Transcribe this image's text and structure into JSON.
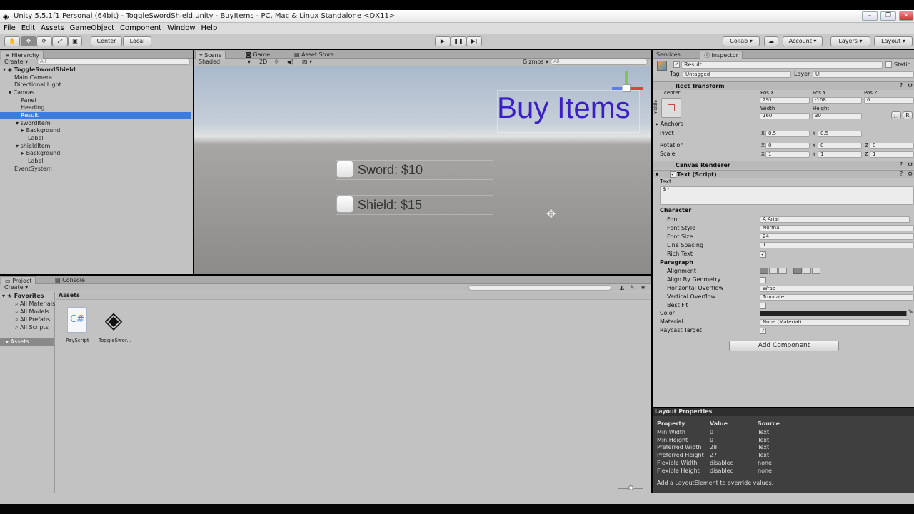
{
  "window": {
    "title": "Unity 5.5.1f1 Personal (64bit) - ToggleSwordShield.unity - BuyItems - PC, Mac & Linux Standalone <DX11>"
  },
  "menu": [
    "File",
    "Edit",
    "Assets",
    "GameObject",
    "Component",
    "Window",
    "Help"
  ],
  "toolbar": {
    "pivot": "Center",
    "space": "Local",
    "collab": "Collab",
    "account": "Account",
    "layers": "Layers",
    "layout": "Layout"
  },
  "hierarchy": {
    "tab": "Hierarchy",
    "create": "Create",
    "search_placeholder": "All",
    "scene": "ToggleSwordShield",
    "items": [
      "Main Camera",
      "Directional Light",
      "Canvas",
      "Panel",
      "Heading",
      "Result",
      "swordItem",
      "Background",
      "Label",
      "shieldItem",
      "Background",
      "Label",
      "EventSystem"
    ]
  },
  "scene": {
    "tabs": [
      "Scene",
      "Game",
      "Asset Store"
    ],
    "shading": "Shaded",
    "mode_2d": "2D",
    "gizmos": "Gizmos",
    "search_placeholder": "All",
    "heading": "Buy Items",
    "sword_label": "Sword: $10",
    "shield_label": "Shield: $15",
    "colors": {
      "heading": "#3a1ec7",
      "sky_top": "#a9b8cc",
      "ground": "#8d8b89"
    }
  },
  "project": {
    "tabs": [
      "Project",
      "Console"
    ],
    "create": "Create",
    "favorites": "Favorites",
    "fav_items": [
      "All Materials",
      "All Models",
      "All Prefabs",
      "All Scripts"
    ],
    "assets_root": "Assets",
    "breadcrumb": "Assets",
    "files": [
      {
        "name": "PayScript",
        "icon": "csharp-script-icon"
      },
      {
        "name": "ToggleSwor...",
        "icon": "unity-scene-icon"
      }
    ]
  },
  "inspector": {
    "tabs": [
      "Services",
      "Inspector"
    ],
    "object_name": "Result",
    "static": "Static",
    "tag_label": "Tag",
    "tag": "Untagged",
    "layer_label": "Layer",
    "layer": "UI",
    "rect_transform": "Rect Transform",
    "anchor_preset": "center",
    "anchor_side": "middle",
    "pos_x_label": "Pos X",
    "pos_y_label": "Pos Y",
    "pos_z_label": "Pos Z",
    "pos_x": "291",
    "pos_y": "-108",
    "pos_z": "0",
    "width_label": "Width",
    "height_label": "Height",
    "width": "160",
    "height": "30",
    "anchors": "Anchors",
    "pivot": "Pivot",
    "pivot_x": "0.5",
    "pivot_y": "0.5",
    "rotation": "Rotation",
    "rot_x": "0",
    "rot_y": "0",
    "rot_z": "0",
    "scale": "Scale",
    "scale_x": "1",
    "scale_y": "1",
    "scale_z": "1",
    "canvas_renderer": "Canvas Renderer",
    "text_script": "Text (Script)",
    "text_label": "Text",
    "text_value": "$ -",
    "character": "Character",
    "font_label": "Font",
    "font": "Arial",
    "font_style_label": "Font Style",
    "font_style": "Normal",
    "font_size_label": "Font Size",
    "font_size": "24",
    "line_spacing_label": "Line Spacing",
    "line_spacing": "1",
    "rich_text": "Rich Text",
    "paragraph": "Paragraph",
    "alignment": "Alignment",
    "align_geometry": "Align By Geometry",
    "h_overflow_label": "Horizontal Overflow",
    "h_overflow": "Wrap",
    "v_overflow_label": "Vertical Overflow",
    "v_overflow": "Truncate",
    "best_fit": "Best Fit",
    "color": "Color",
    "material_label": "Material",
    "material": "None (Material)",
    "raycast": "Raycast Target",
    "add_component": "Add Component"
  },
  "layout_props": {
    "title": "Layout Properties",
    "headers": [
      "Property",
      "Value",
      "Source"
    ],
    "rows": [
      [
        "Min Width",
        "0",
        "Text"
      ],
      [
        "Min Height",
        "0",
        "Text"
      ],
      [
        "Preferred Width",
        "28",
        "Text"
      ],
      [
        "Preferred Height",
        "27",
        "Text"
      ],
      [
        "Flexible Width",
        "disabled",
        "none"
      ],
      [
        "Flexible Height",
        "disabled",
        "none"
      ]
    ],
    "note": "Add a LayoutElement to override values."
  }
}
